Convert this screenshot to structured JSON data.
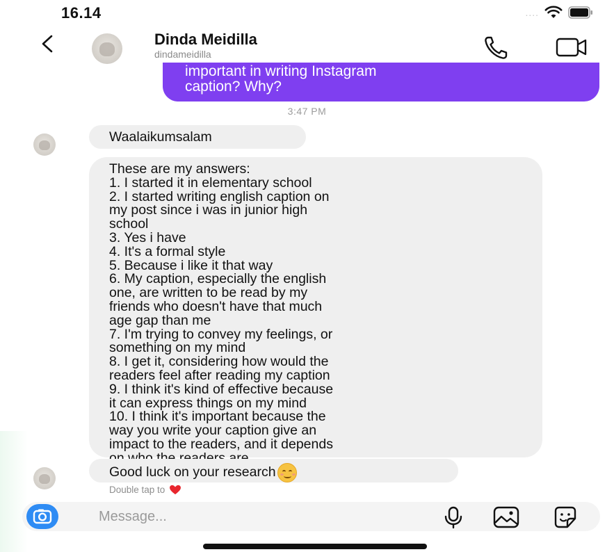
{
  "status_bar": {
    "time": "16.14",
    "signal": "....",
    "wifi_icon": "wifi-icon",
    "battery_icon": "battery-icon"
  },
  "header": {
    "back_icon": "chevron-left-icon",
    "contact_name": "Dinda Meidilla",
    "contact_handle": "dindameidilla",
    "call_icon": "phone-icon",
    "video_icon": "video-camera-icon"
  },
  "colors": {
    "sent_bubble": "#7f3ff0",
    "received_bubble": "#efefef",
    "camera_button": "#2f8cf4",
    "heart": "#e8262e"
  },
  "conversation": {
    "sent_message_lines": [
      "important in writing Instagram",
      "caption? Why?"
    ],
    "timestamp": "3:47 PM",
    "received": [
      {
        "lines": [
          "Waalaikumsalam"
        ]
      },
      {
        "lines": [
          "These are my answers:",
          "1. I started it in elementary school",
          "2. I started writing english caption on",
          "my post since i was in junior high",
          "school",
          "3. Yes i have",
          "4. It's a formal style",
          "5. Because i like it that way",
          "6. My caption, especially the english",
          "one, are written to be read by my",
          "friends who doesn't have that much",
          "age gap than me",
          "7. I'm trying to convey my feelings, or",
          "something on my mind",
          "8. I get it, considering how would the",
          "readers feel after reading my caption",
          "9. I think it's kind of effective because",
          "it can express things on my mind",
          "10. I think it's important because the",
          "way you write your caption give an",
          "impact to the readers, and it depends",
          "on who the readers are."
        ]
      },
      {
        "lines": [
          "Good luck on your research"
        ],
        "emoji": "smiling-face-emoji"
      }
    ],
    "double_tap_hint": "Double tap to"
  },
  "composer": {
    "placeholder": "Message...",
    "camera_icon": "camera-icon",
    "mic_icon": "microphone-icon",
    "gallery_icon": "gallery-icon",
    "sticker_icon": "sticker-icon"
  }
}
